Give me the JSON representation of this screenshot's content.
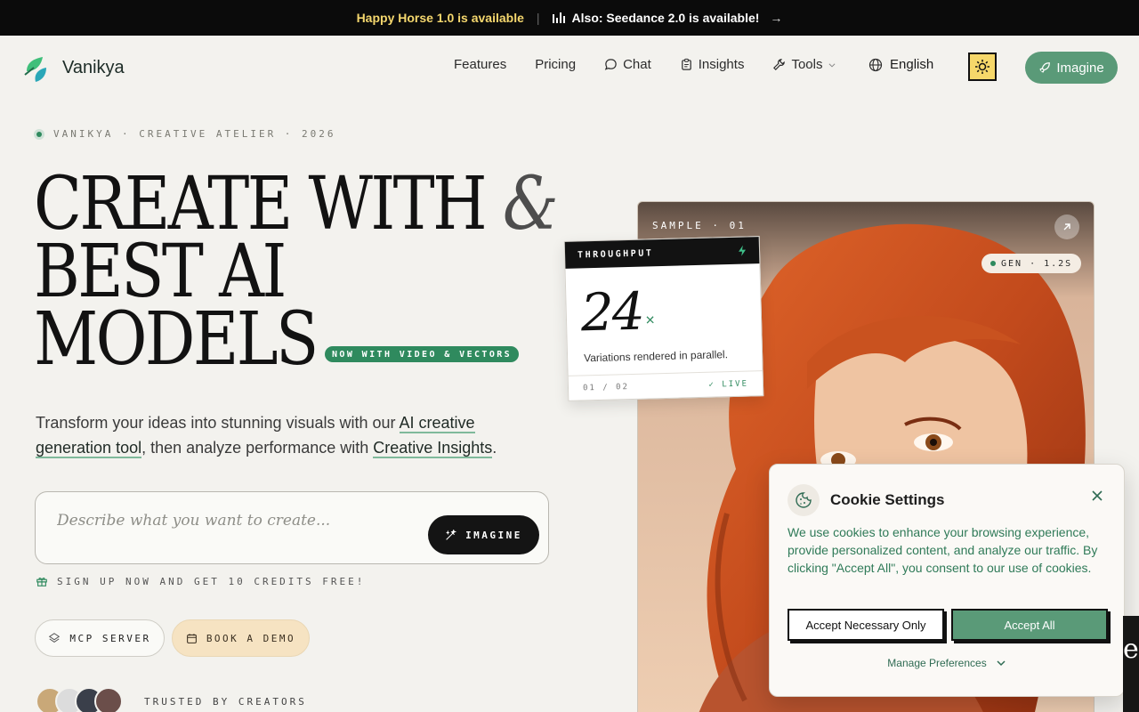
{
  "announcement": {
    "primary": "Happy Horse 1.0 is available",
    "separator": "|",
    "secondary": "Also: Seedance 2.0 is available!",
    "arrow": "→"
  },
  "nav": {
    "brand": "Vanikya",
    "links": [
      "Features",
      "Pricing",
      "Chat",
      "Insights",
      "Tools"
    ],
    "language": "English",
    "cta": "Imagine"
  },
  "hero": {
    "eyebrow": "VANIKYA · CREATIVE ATELIER · 2026",
    "headline_line1": "CREATE WITH",
    "headline_amp": "&",
    "headline_line2": "BEST AI",
    "headline_line3": "MODELS",
    "badge": "NOW WITH VIDEO & VECTORS",
    "sub_pre": "Transform your ideas into stunning visuals with our ",
    "sub_link1": "AI creative generation tool",
    "sub_mid": ", then analyze performance with ",
    "sub_link2": "Creative Insights",
    "sub_post": ".",
    "prompt_placeholder": "Describe what you want to create...",
    "prompt_button": "IMAGINE",
    "credits": "SIGN UP NOW AND GET 10 CREDITS FREE!",
    "btn_mcp": "MCP SERVER",
    "btn_demo": "BOOK A DEMO",
    "trusted": "TRUSTED BY CREATORS"
  },
  "showcase": {
    "sample_label": "SAMPLE · 01",
    "gen_label": "GEN · 1.2S",
    "throughput": {
      "title": "THROUGHPUT",
      "value": "24",
      "unit": "×",
      "caption": "Variations rendered in parallel.",
      "pager": "01 / 02",
      "status": "✓ LIVE"
    }
  },
  "cookie": {
    "title": "Cookie Settings",
    "body": "We use cookies to enhance your browsing experience, provide personalized content, and analyze our traffic. By clicking \"Accept All\", you consent to our use of cookies.",
    "accept_necessary": "Accept Necessary Only",
    "accept_all": "Accept All",
    "manage": "Manage Preferences"
  },
  "colors": {
    "accent": "#5a9a78",
    "brand_green": "#2f8a5e",
    "announce_yellow": "#f5d76e",
    "theme_button": "#f6d86a"
  }
}
